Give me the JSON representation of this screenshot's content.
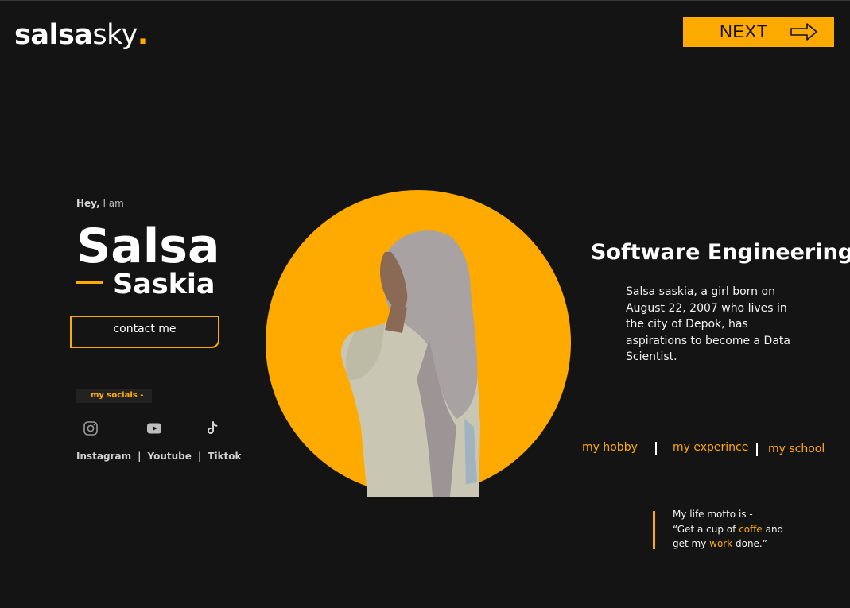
{
  "brand": {
    "part1": "salsa",
    "part2": "sky",
    "dot": "."
  },
  "nav": {
    "next_label": "NEXT"
  },
  "intro": {
    "greeting_bold": "Hey,",
    "greeting_rest": " I am",
    "first_name": "Salsa",
    "last_name": "Saskia"
  },
  "contact": {
    "label": "contact me"
  },
  "socials": {
    "tag": "my socials -",
    "icons": [
      "instagram-icon",
      "youtube-icon",
      "tiktok-icon"
    ],
    "labels": [
      "Instagram",
      "Youtube",
      "Tiktok"
    ],
    "separator": "|"
  },
  "about": {
    "title": "Software Engineering",
    "bio": "Salsa saskia, a girl born on August 22, 2007 who lives in the city of Depok, has aspirations to become a Data Scientist."
  },
  "links": [
    "my hobby",
    "my experince",
    "my school"
  ],
  "motto": {
    "intro": "My life motto is -",
    "quote_start": "“Get a cup of ",
    "highlight1": "coffe",
    "quote_mid": " and get my ",
    "highlight2": "work",
    "quote_end": " done.”"
  },
  "colors": {
    "accent": "#FFAA00",
    "background": "#141414",
    "text": "#FFFFFF"
  }
}
